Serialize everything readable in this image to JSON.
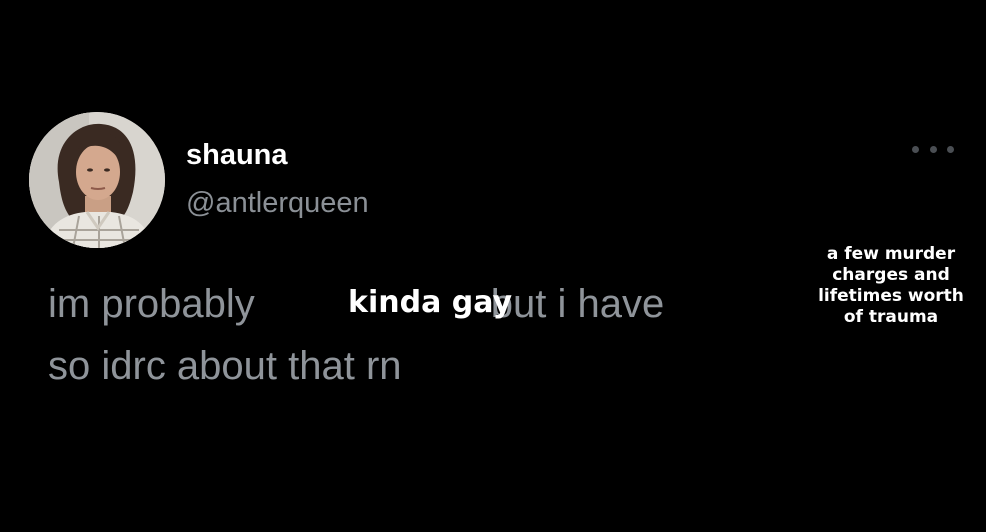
{
  "tweet": {
    "display_name": "shauna",
    "handle": "@antlerqueen",
    "text_part1": "im probably",
    "text_part2": "but i have",
    "text_line2": "so idrc about that rn",
    "more_icon": "more-horizontal-icon"
  },
  "overlay": {
    "inserted_phrase": "kinda gay",
    "inserted_caption": "a few murder\ncharges and\nlifetimes worth\nof trauma"
  },
  "colors": {
    "background": "#000000",
    "name": "#ffffff",
    "secondary_text": "#8b9096",
    "overlay_text": "#ffffff"
  }
}
